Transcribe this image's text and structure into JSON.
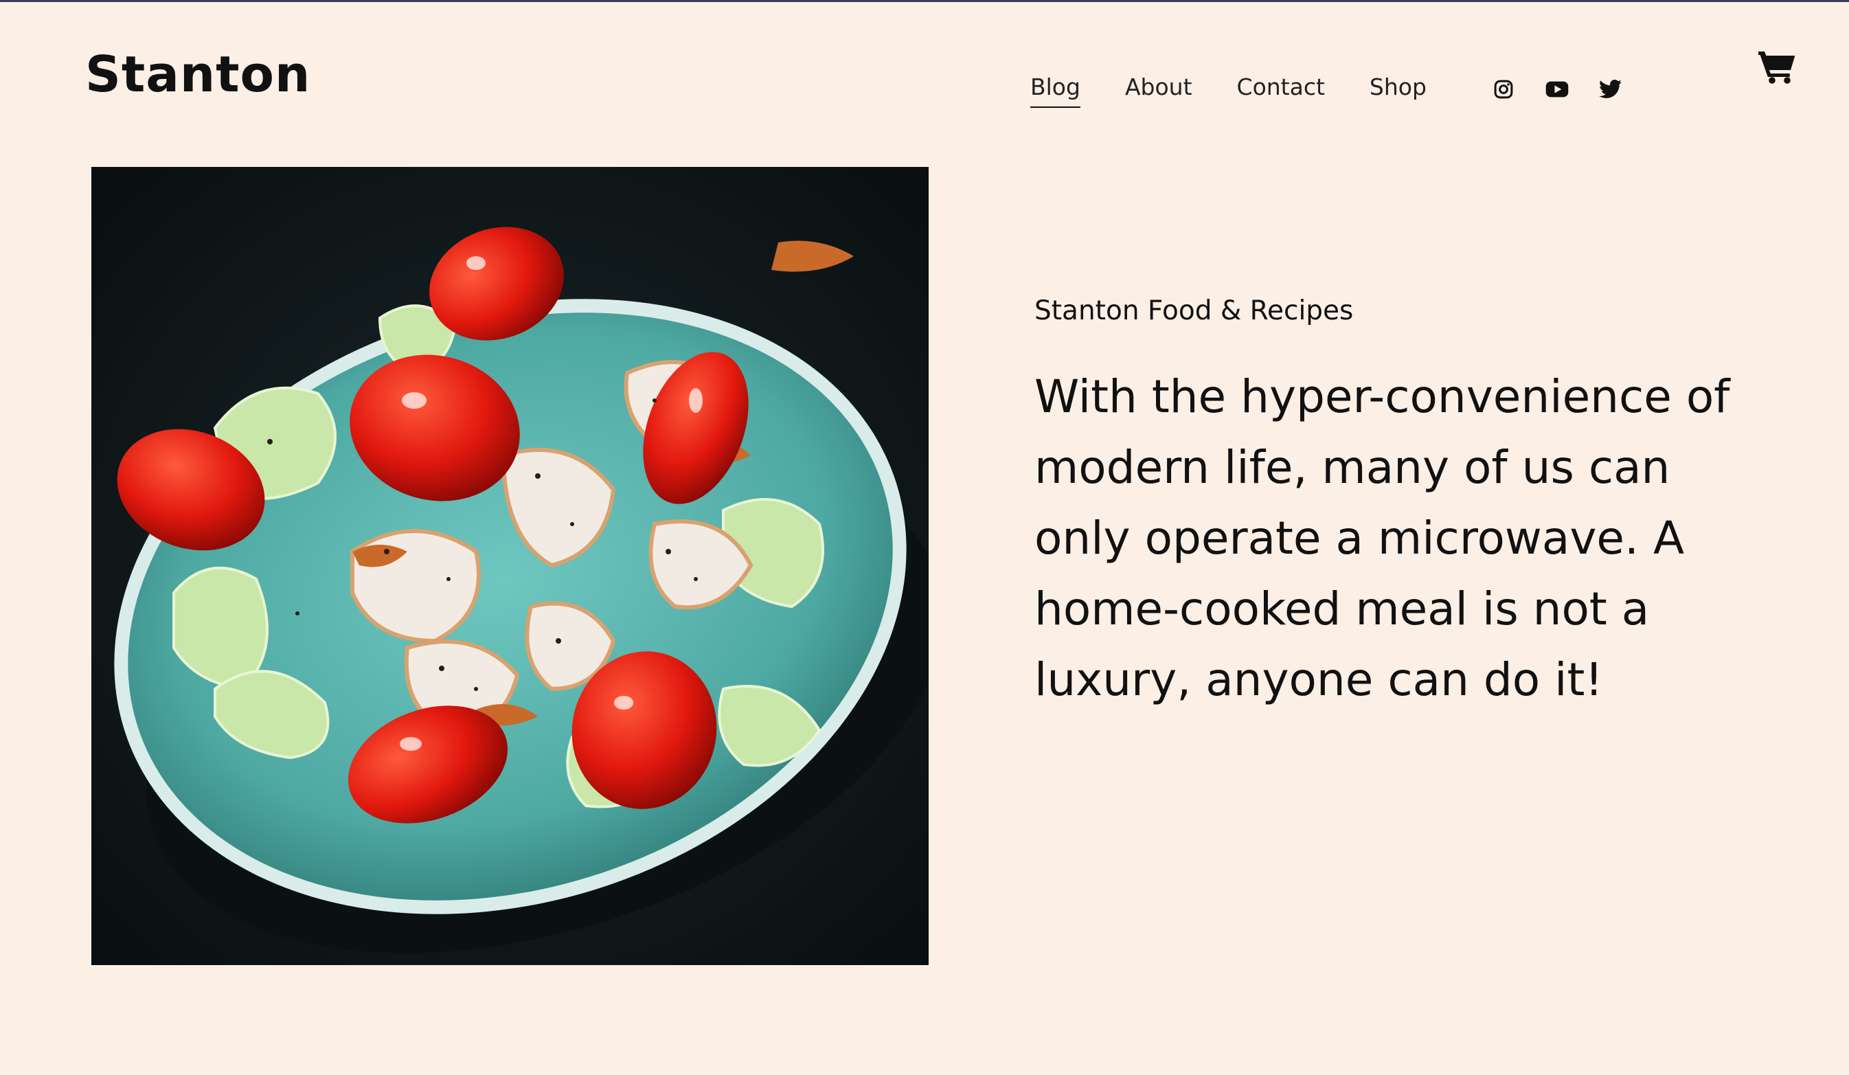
{
  "site": {
    "logo": "Stanton"
  },
  "nav": {
    "items": [
      {
        "label": "Blog",
        "active": true
      },
      {
        "label": "About",
        "active": false
      },
      {
        "label": "Contact",
        "active": false
      },
      {
        "label": "Shop",
        "active": false
      }
    ]
  },
  "socials": [
    {
      "icon": "instagram-icon"
    },
    {
      "icon": "youtube-icon"
    },
    {
      "icon": "twitter-icon"
    }
  ],
  "cart": {
    "icon": "cart-icon"
  },
  "hero": {
    "image": "salad-bowl-photo",
    "subtitle": "Stanton Food & Recipes",
    "headline": "With the hyper-convenience of modern life, many of us can only operate a microwave. A home-cooked meal is not a luxury, anyone can do it!"
  },
  "colors": {
    "background": "#fcefe6",
    "text": "#111111",
    "top_line": "#3d3a5c"
  }
}
